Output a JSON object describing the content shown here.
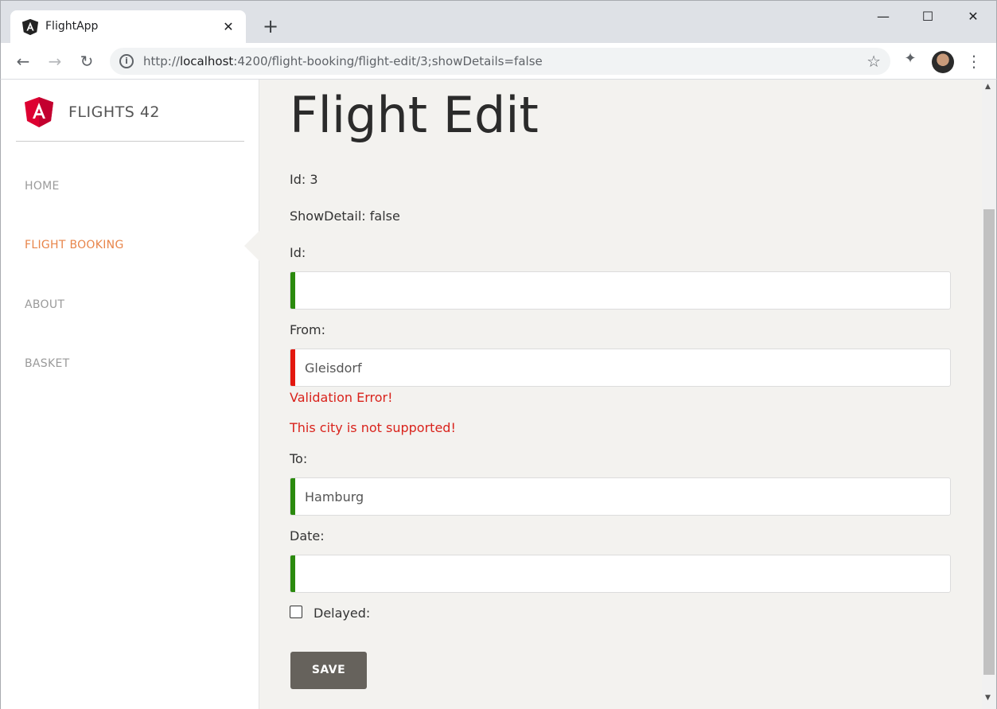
{
  "browser": {
    "tab_title": "FlightApp",
    "tab_close": "✕",
    "new_tab": "+",
    "window_min": "—",
    "window_max": "☐",
    "window_close": "✕",
    "url_prefix": "http://",
    "url_host": "localhost",
    "url_rest": ":4200/flight-booking/flight-edit/3;showDetails=false",
    "icons": {
      "back": "arrow-left-icon",
      "forward": "arrow-right-icon",
      "reload": "reload-icon",
      "info": "info-icon",
      "bookmark": "star-icon",
      "extensions": "puzzle-icon",
      "profile": "avatar",
      "menu": "kebab-menu-icon"
    }
  },
  "sidebar": {
    "brand": "FLIGHTS 42",
    "items": [
      {
        "label": "HOME",
        "active": false
      },
      {
        "label": "FLIGHT BOOKING",
        "active": true
      },
      {
        "label": "ABOUT",
        "active": false
      },
      {
        "label": "BASKET",
        "active": false
      }
    ]
  },
  "main": {
    "title": "Flight Edit",
    "id_line": "Id: 3",
    "show_detail_line": "ShowDetail: false",
    "fields": {
      "id": {
        "label": "Id:",
        "value": "",
        "status": "valid"
      },
      "from": {
        "label": "From:",
        "value": "Gleisdorf",
        "status": "invalid"
      },
      "to": {
        "label": "To:",
        "value": "Hamburg",
        "status": "valid"
      },
      "date": {
        "label": "Date:",
        "value": "",
        "status": "valid"
      }
    },
    "errors": {
      "validation": "Validation Error!",
      "city": "This city is not supported!"
    },
    "delayed_label": "Delayed:",
    "delayed_checked": false,
    "save_label": "SAVE"
  },
  "colors": {
    "accent": "#e8854a",
    "valid": "#2b8a0e",
    "invalid": "#e3180f",
    "error_text": "#d9231c",
    "button": "#66625c",
    "background": "#f3f2ef"
  }
}
